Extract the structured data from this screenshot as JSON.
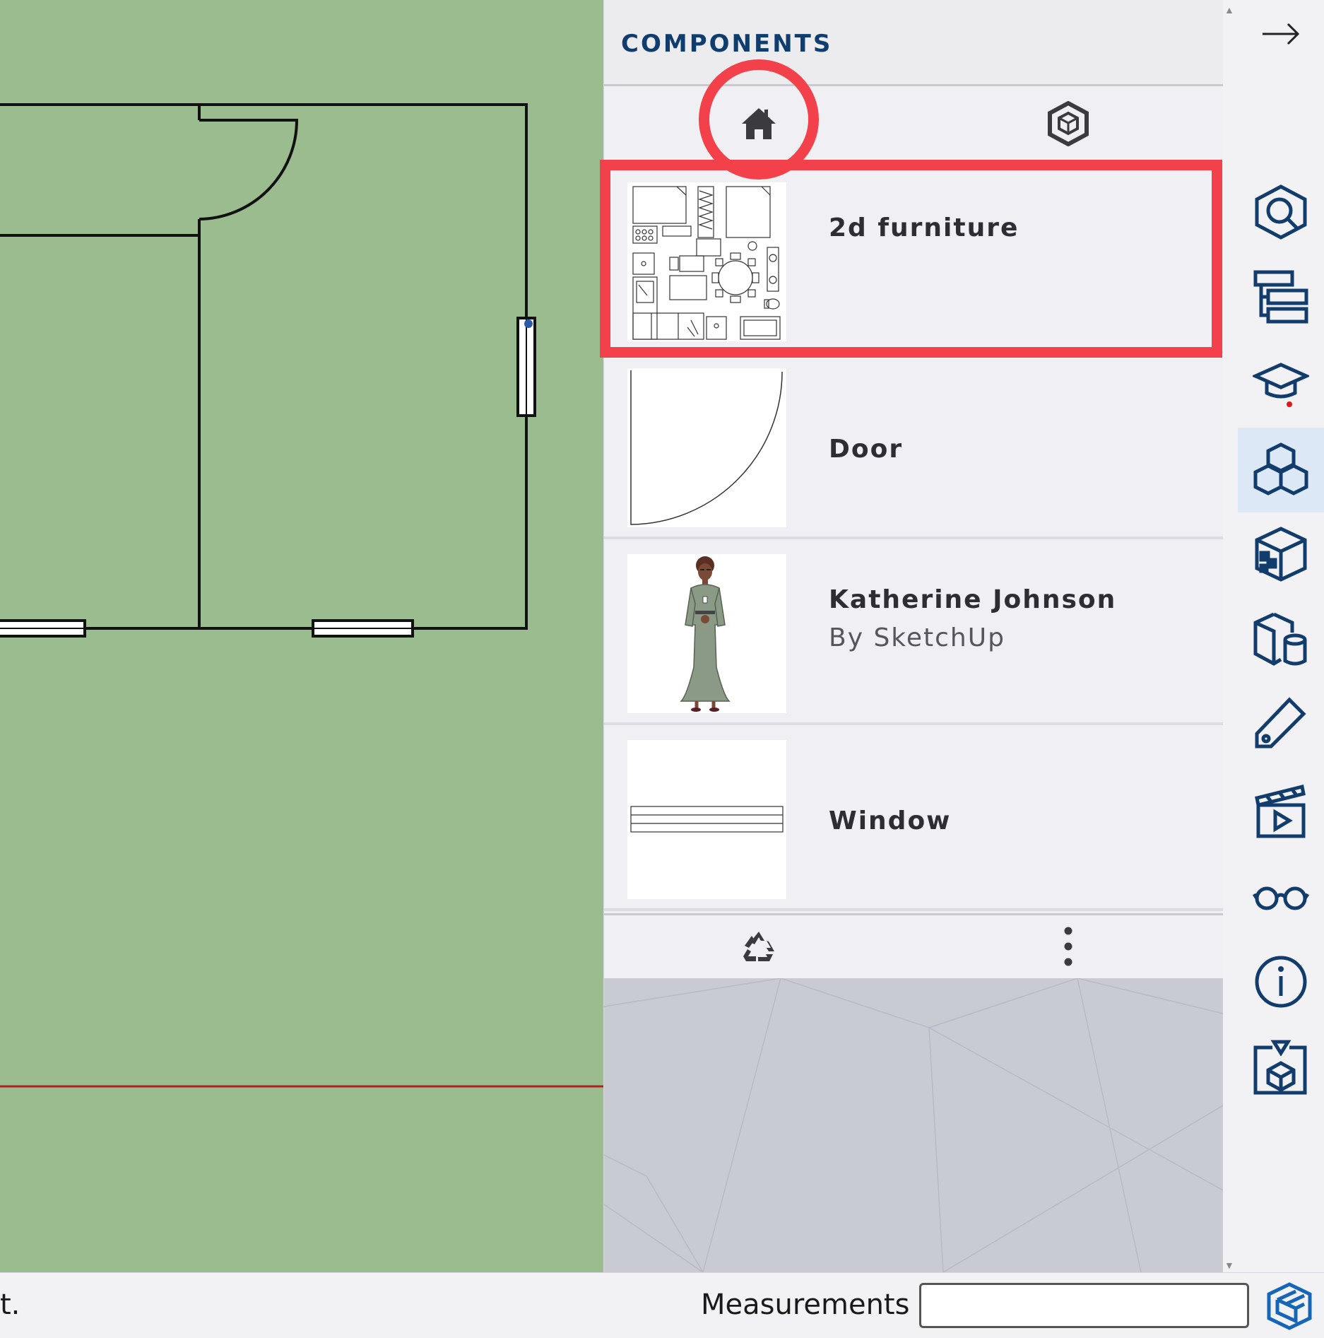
{
  "panel": {
    "title": "COMPONENTS",
    "tabs": [
      {
        "name": "home",
        "icon": "home-icon"
      },
      {
        "name": "in-model",
        "icon": "model-hexagon-icon"
      }
    ],
    "items": [
      {
        "label": "2d furniture",
        "subtitle": ""
      },
      {
        "label": "Door",
        "subtitle": ""
      },
      {
        "label": "Katherine Johnson",
        "subtitle": "By SketchUp"
      },
      {
        "label": "Window",
        "subtitle": ""
      }
    ],
    "footer": {
      "purge_icon": "recycle-icon",
      "menu_icon": "more-vertical-icon"
    }
  },
  "toolbar": {
    "collapse_icon": "arrow-right-icon",
    "tools": [
      {
        "name": "search-3d-warehouse",
        "icon": "search-cube-icon",
        "active": false
      },
      {
        "name": "outliner",
        "icon": "outliner-icon",
        "active": false
      },
      {
        "name": "instructor",
        "icon": "graduation-cap-icon",
        "active": false
      },
      {
        "name": "components",
        "icon": "components-icon",
        "active": true
      },
      {
        "name": "materials",
        "icon": "materials-icon",
        "active": false
      },
      {
        "name": "styles",
        "icon": "styles-icon",
        "active": false
      },
      {
        "name": "tags",
        "icon": "tag-icon",
        "active": false
      },
      {
        "name": "scenes",
        "icon": "scenes-icon",
        "active": false
      },
      {
        "name": "display",
        "icon": "glasses-icon",
        "active": false
      },
      {
        "name": "entity-info",
        "icon": "info-icon",
        "active": false
      },
      {
        "name": "extension-warehouse",
        "icon": "extension-icon",
        "active": false
      }
    ]
  },
  "status": {
    "left_text": "t.",
    "measurements_label": "Measurements",
    "measurements_value": ""
  },
  "colors": {
    "accent": "#0f3d6e",
    "highlight": "#f2414a",
    "viewport_bg": "#9bbc8f",
    "axis_red": "#b22222"
  }
}
